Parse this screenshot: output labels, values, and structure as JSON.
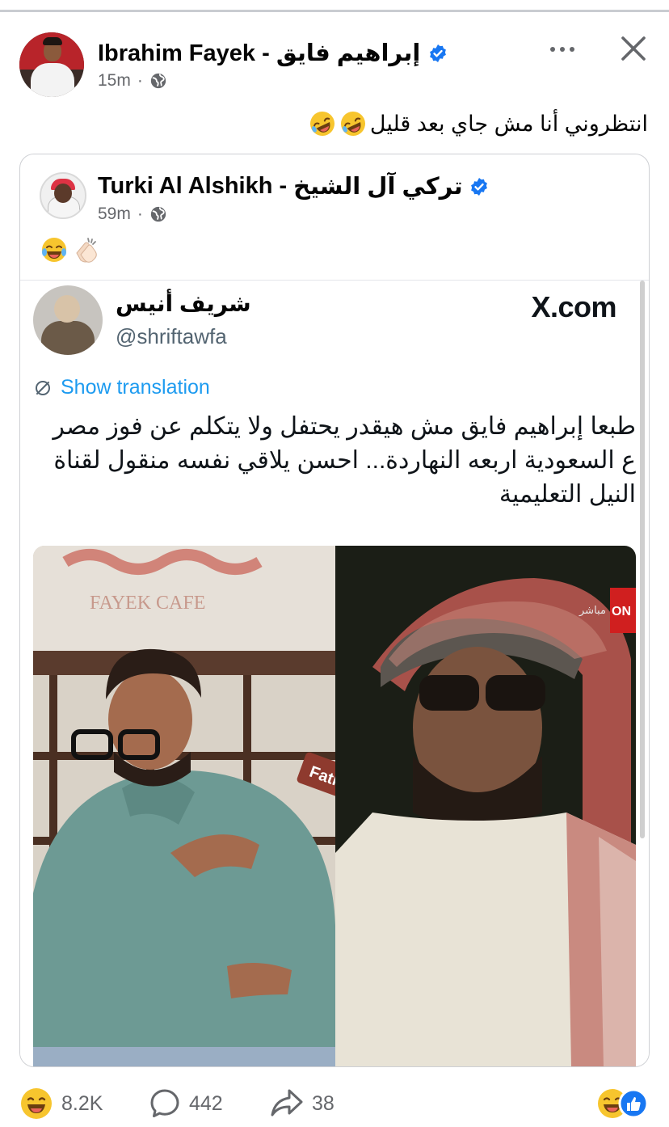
{
  "post": {
    "author": "Ibrahim Fayek - إبراهيم  فايق",
    "time": "15m",
    "text": "انتظروني أنا مش جاي بعد قليل"
  },
  "shared": {
    "author_en": "Turki Al Alshikh -",
    "author_ar": "تركي  آل  الشيخ",
    "time": "59m"
  },
  "tweet": {
    "name": "شريف أنيس",
    "handle": "@shriftawfa",
    "site": "X.com",
    "translate_label": "Show translation",
    "text": "طبعا إبراهيم فايق مش هيقدر يحتفل ولا يتكلم عن فوز مصر ع السعودية اربعه النهاردة... احسن يلاقي نفسه منقول لقناة النيل التعليمية",
    "image": {
      "caf_sign": "FAYEK CAFE",
      "sticker": "Fathy",
      "channel": "مباشر",
      "channel_logo": "ON"
    }
  },
  "footer": {
    "reactions": "8.2K",
    "comments": "442",
    "shares": "38"
  },
  "icons": {
    "more": "more-horizontal-icon",
    "close": "close-icon",
    "privacy": "globe-icon",
    "verified": "verified-badge-icon",
    "comment": "comment-icon",
    "share": "share-icon"
  },
  "colors": {
    "verified": "#1877f2",
    "x_link": "#1d9bf0",
    "meta_text": "#65676b"
  }
}
